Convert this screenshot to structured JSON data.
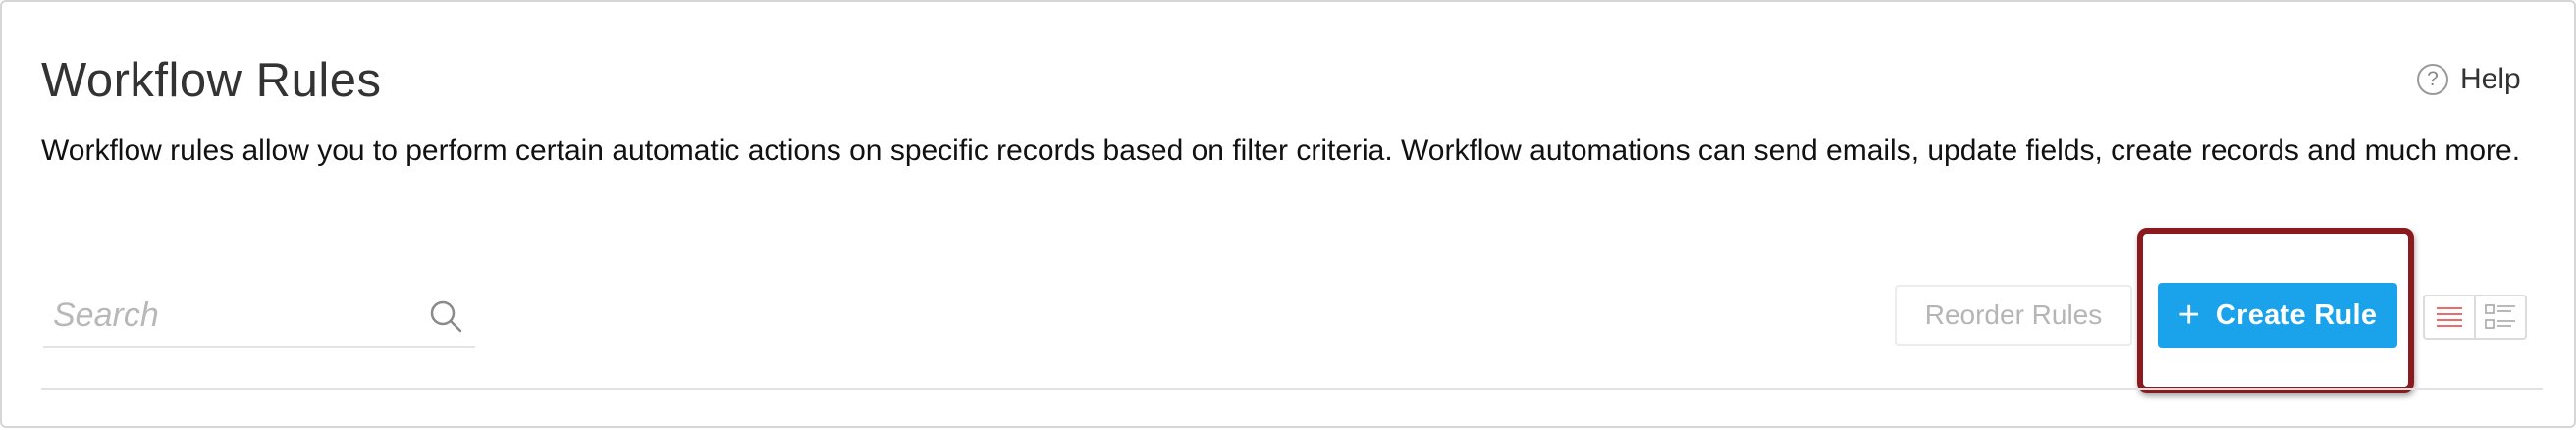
{
  "header": {
    "title": "Workflow Rules",
    "help_label": "Help",
    "help_icon_glyph": "?"
  },
  "description": "Workflow rules allow you to perform certain automatic actions on specific records based on filter criteria. Workflow automations can send emails, update fields, create records and much more.",
  "search": {
    "placeholder": "Search",
    "value": "",
    "icon": "search-icon"
  },
  "toolbar": {
    "reorder_label": "Reorder Rules",
    "create_label": "Create Rule",
    "create_icon_glyph": "+",
    "view_modes": [
      "list-view-icon",
      "detail-view-icon"
    ],
    "active_view": "list-view-icon"
  },
  "colors": {
    "accent": "#1aa3ea",
    "highlight_border": "#8b1a1f",
    "active_view_icon": "#f06a6a",
    "inactive_view_icon": "#b0b0b0"
  }
}
